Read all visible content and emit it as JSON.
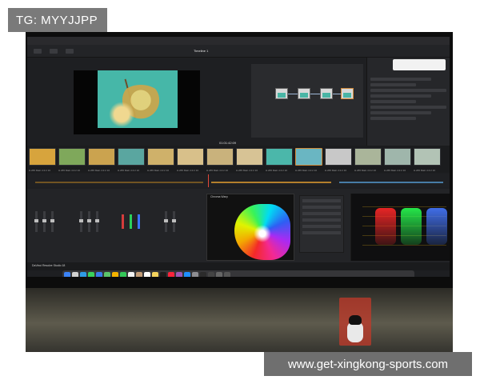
{
  "watermarks": {
    "top": "TG: MYYJJPP",
    "bottom": "www.get-xingkong-sports.com"
  },
  "app": {
    "name": "DaVinci Resolve",
    "bottom_label": "DaVinci Resolve Studio 18"
  },
  "ui": {
    "timeline_label": "Timeline 1",
    "timecode": "01:01:42:09",
    "chroma_title": "Chroma Warp",
    "clips": [
      {
        "color": "#d7a43d",
        "label": "H.265 Main 4:2:2 10"
      },
      {
        "color": "#7fa85b",
        "label": "H.265 Main 4:2:2 10"
      },
      {
        "color": "#cba34f",
        "label": "H.265 Main 4:2:2 10"
      },
      {
        "color": "#5aa6a0",
        "label": "H.265 Main 4:2:2 10"
      },
      {
        "color": "#cfb16a",
        "label": "H.265 Main 4:2:2 10"
      },
      {
        "color": "#d8c08a",
        "label": "H.265 Main 4:2:2 10"
      },
      {
        "color": "#c9b27c",
        "label": "H.265 Main 4:2:2 10"
      },
      {
        "color": "#d7c395",
        "label": "H.265 Main 4:2:2 10"
      },
      {
        "color": "#4bb7aa",
        "label": "H.265 Main 4:2:2 10"
      },
      {
        "color": "#6ab6c2",
        "label": "H.265 Main 4:2:2 10",
        "selected": true
      },
      {
        "color": "#c8c8c8",
        "label": "H.265 Main 4:2:2 10"
      },
      {
        "color": "#aab59a",
        "label": "H.265 Main 4:2:2 10"
      },
      {
        "color": "#9fb6ab",
        "label": "H.265 Main 4:2:2 10"
      },
      {
        "color": "#b2c3b5",
        "label": "H.265 Main 4:2:2 10"
      }
    ]
  },
  "colors": {
    "accent_orange": "#d18b3a",
    "playhead": "#e2483a"
  },
  "dock_icons": [
    {
      "name": "finder-icon",
      "color": "#3b83f6"
    },
    {
      "name": "launchpad-icon",
      "color": "#d2d2d2"
    },
    {
      "name": "safari-icon",
      "color": "#2f9be6"
    },
    {
      "name": "messages-icon",
      "color": "#3ad15b"
    },
    {
      "name": "mail-icon",
      "color": "#3a7bea"
    },
    {
      "name": "maps-icon",
      "color": "#5bc46a"
    },
    {
      "name": "photos-icon",
      "color": "#f5b400"
    },
    {
      "name": "facetime-icon",
      "color": "#34c759"
    },
    {
      "name": "calendar-icon",
      "color": "#f2f2f2"
    },
    {
      "name": "contacts-icon",
      "color": "#c29c77"
    },
    {
      "name": "reminders-icon",
      "color": "#ffffff"
    },
    {
      "name": "notes-icon",
      "color": "#f4d35e"
    },
    {
      "name": "tv-icon",
      "color": "#1c1c1c"
    },
    {
      "name": "music-icon",
      "color": "#fa233b"
    },
    {
      "name": "podcasts-icon",
      "color": "#9b59b6"
    },
    {
      "name": "appstore-icon",
      "color": "#1e90ff"
    },
    {
      "name": "settings-icon",
      "color": "#8e8e93"
    },
    {
      "name": "resolve-icon",
      "color": "#2b2b2b"
    },
    {
      "name": "app-1-icon",
      "color": "#444"
    },
    {
      "name": "app-2-icon",
      "color": "#666"
    },
    {
      "name": "app-3-icon",
      "color": "#555"
    }
  ]
}
